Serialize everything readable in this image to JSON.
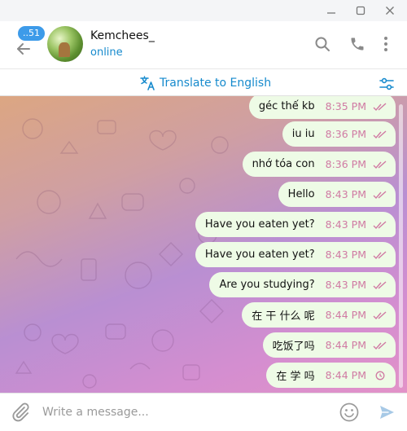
{
  "window": {
    "controls": [
      "minimize-icon",
      "maximize-icon",
      "close-icon"
    ]
  },
  "header": {
    "unread_badge": "..51",
    "contact_name": "Kemchees_",
    "status": "online",
    "icons": [
      "back-arrow-icon",
      "search-icon",
      "phone-icon",
      "more-vertical-icon"
    ]
  },
  "translate_bar": {
    "label": "Translate to English",
    "icons": [
      "translate-icon",
      "settings-sliders-icon"
    ]
  },
  "messages": [
    {
      "text": "géc thế kb",
      "time": "8:35 PM",
      "status": "read"
    },
    {
      "text": "iu iu",
      "time": "8:36 PM",
      "status": "read"
    },
    {
      "text": "nhớ tóa con",
      "time": "8:36 PM",
      "status": "read"
    },
    {
      "text": "Hello",
      "time": "8:43 PM",
      "status": "read"
    },
    {
      "text": "Have you eaten yet?",
      "time": "8:43 PM",
      "status": "read"
    },
    {
      "text": "Have you eaten yet?",
      "time": "8:43 PM",
      "status": "read"
    },
    {
      "text": "Are you studying?",
      "time": "8:43 PM",
      "status": "read"
    },
    {
      "text": "在 干 什么 呢",
      "time": "8:44 PM",
      "status": "read"
    },
    {
      "text": "吃饭了吗",
      "time": "8:44 PM",
      "status": "read"
    },
    {
      "text": "在 学 吗",
      "time": "8:44 PM",
      "status": "sending"
    }
  ],
  "composer": {
    "placeholder": "Write a message...",
    "value": "",
    "icons": [
      "paperclip-icon",
      "emoji-icon",
      "send-icon"
    ]
  },
  "colors": {
    "accent": "#168acd",
    "badge": "#3d9be9",
    "bubble": "#eefbe6",
    "time_text": "#d07aa3"
  }
}
